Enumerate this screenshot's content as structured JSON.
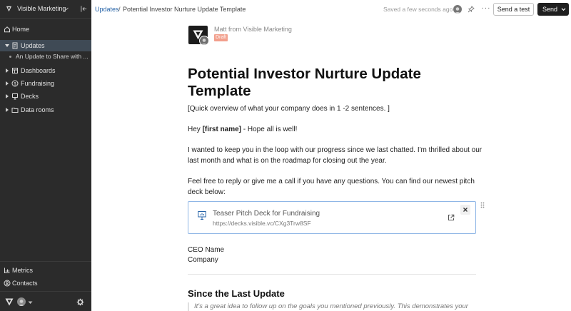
{
  "sidebar": {
    "workspace_name": "Visible Marketing",
    "nav": {
      "home": "Home",
      "updates": "Updates",
      "updates_child": "An Update to Share with ...",
      "dashboards": "Dashboards",
      "fundraising": "Fundraising",
      "decks": "Decks",
      "data_rooms": "Data rooms"
    },
    "footer": {
      "metrics": "Metrics",
      "contacts": "Contacts"
    }
  },
  "topbar": {
    "breadcrumb_root": "Updates",
    "breadcrumb_separator": "/",
    "breadcrumb_title": "Potential Investor Nurture Update Template",
    "saved_status": "Saved a few seconds ago",
    "more_label": "···",
    "send_test_label": "Send a test",
    "send_label": "Send"
  },
  "document": {
    "sender": "Matt from Visible Marketing",
    "status_badge": "Draft",
    "title": "Potential Investor Nurture Update Template",
    "overview": "[Quick overview of what your company does in 1 -2 sentences. ]",
    "greeting_prefix": "Hey ",
    "greeting_bold": "[first name]",
    "greeting_suffix": " - Hope all is well!",
    "paragraph_progress": "I wanted to keep you in the loop with our progress since we last chatted. I'm thrilled about our last month and what is on the roadmap for closing out the year.",
    "paragraph_reply": "Feel free to reply or give me a call if you have any questions. You can find our newest pitch deck below:",
    "embed": {
      "title": "Teaser Pitch Deck for Fundraising",
      "url": "https://decks.visible.vc/CXg3Trw8SF"
    },
    "signature_name": "CEO Name",
    "signature_company": "Company",
    "section_heading": "Since the Last Update",
    "section_quote": "It's a great idea to follow up on the goals you mentioned previously. This demonstrates your"
  },
  "colors": {
    "sidebar_bg": "#2b2b2b",
    "sidebar_active": "#3f4a55",
    "link": "#2563a8",
    "draft_badge": "#f29f8c",
    "embed_border": "#8fb6e6",
    "send_button": "#1f1f1f"
  }
}
